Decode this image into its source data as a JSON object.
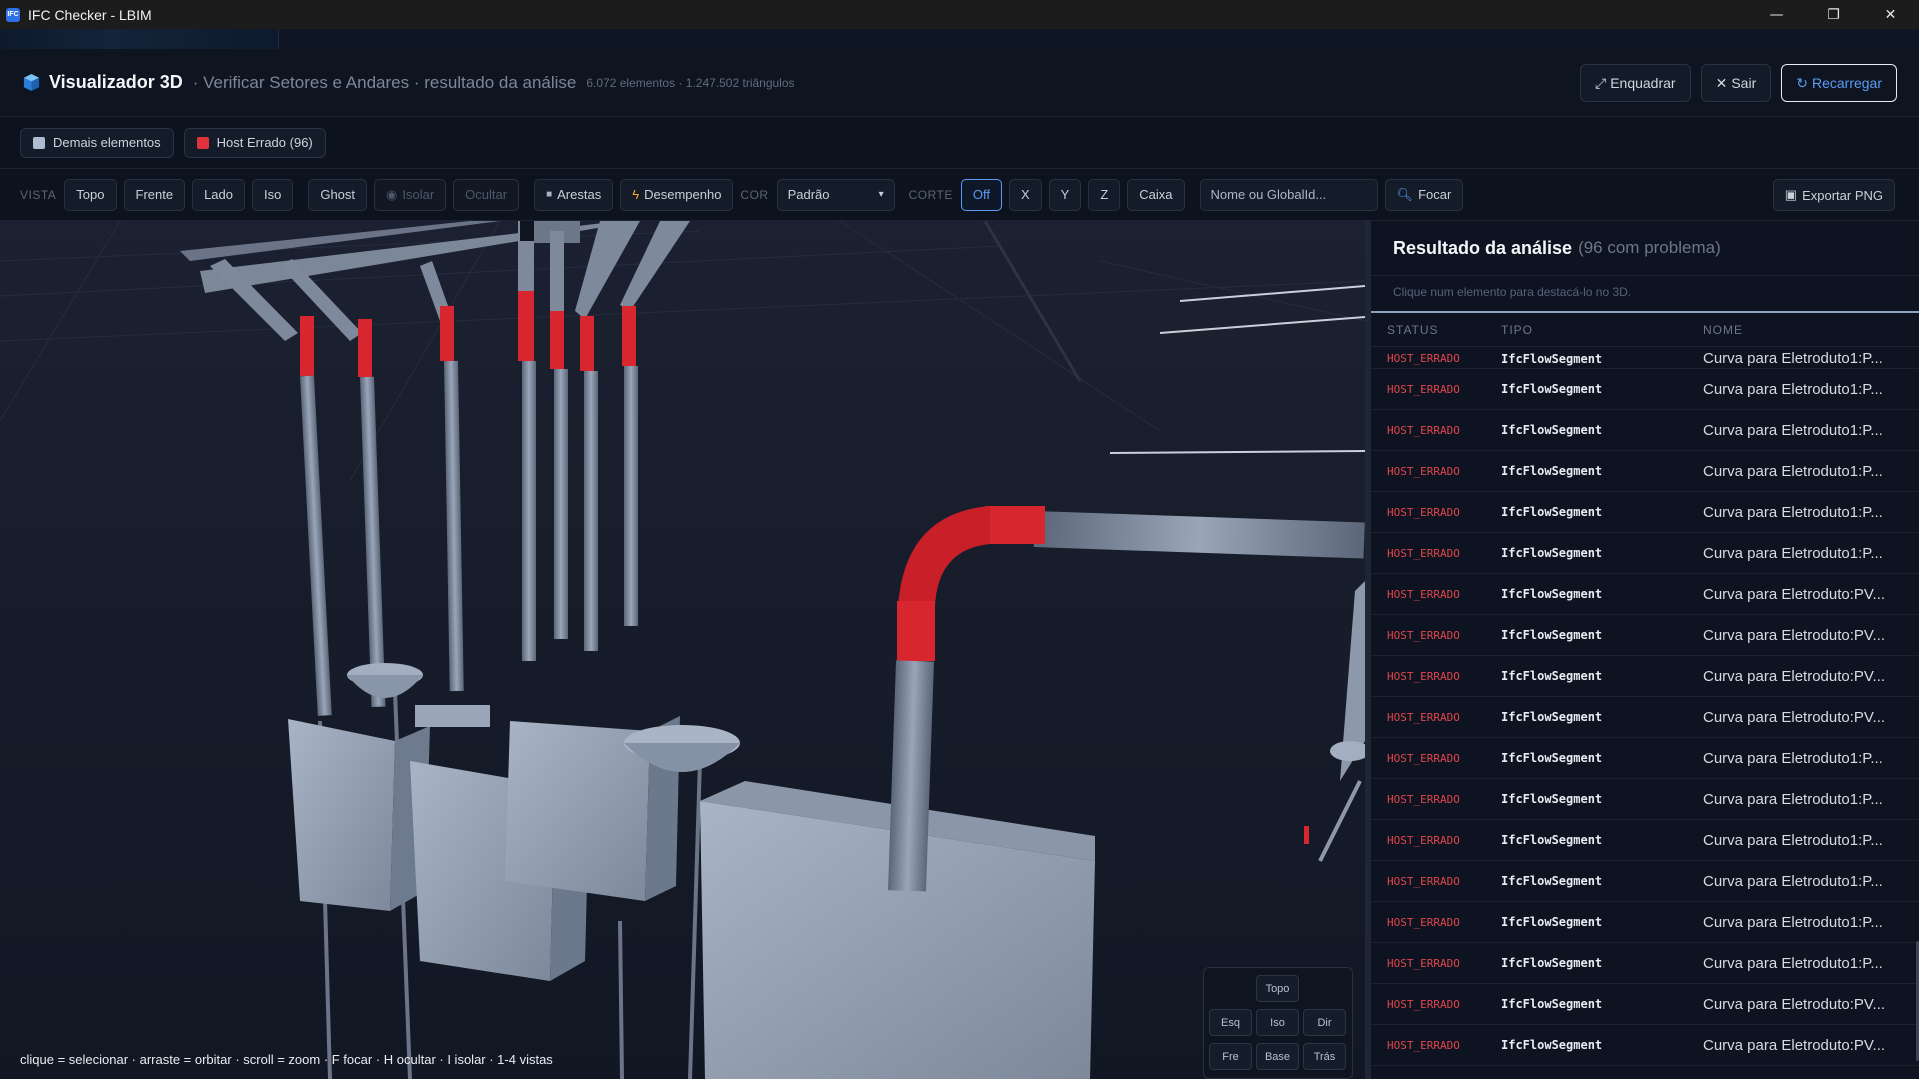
{
  "window": {
    "title": "IFC Checker - LBIM",
    "controls": [
      "minimize",
      "restore",
      "close"
    ]
  },
  "header": {
    "title": "Visualizador 3D",
    "subtitle": "· Verificar Setores e Andares · resultado da análise",
    "stats": "6.072 elementos · 1.247.502 triângulos",
    "actions": {
      "frame": "Enquadrar",
      "exit": "Sair",
      "reload": "Recarregar"
    }
  },
  "legend": {
    "items": [
      {
        "label": "Demais elementos",
        "color": "#aebbd0"
      },
      {
        "label": "Host Errado (96)",
        "color": "#e0343c"
      }
    ]
  },
  "toolbar": {
    "view_label": "VISTA",
    "views": [
      "Topo",
      "Frente",
      "Lado",
      "Iso"
    ],
    "ghost": "Ghost",
    "isolate": "Isolar",
    "hide": "Ocultar",
    "edges": "Arestas",
    "performance": "Desempenho",
    "color_label": "COR",
    "color_value": "Padrão",
    "cut_label": "CORTE",
    "cuts": [
      "Off",
      "X",
      "Y",
      "Z",
      "Caixa"
    ],
    "search_placeholder": "Nome ou GlobalId...",
    "focus": "Focar",
    "export": "Exportar PNG"
  },
  "viewport": {
    "hint": "clique = selecionar · arraste = orbitar · scroll = zoom · F focar · H ocultar · I isolar · 1-4 vistas",
    "navcube": {
      "top": "Topo",
      "left": "Esq",
      "iso": "Iso",
      "right": "Dir",
      "front": "Fre",
      "base": "Base",
      "back": "Trás"
    }
  },
  "panel": {
    "title": "Resultado da análise",
    "count": "(96 com problema)",
    "hint": "Clique num elemento para destacá-lo no 3D.",
    "columns": [
      "STATUS",
      "TIPO",
      "NOME"
    ],
    "rows": [
      {
        "status": "HOST_ERRADO",
        "tipo": "IfcFlowSegment",
        "nome": "Curva para Eletroduto1:P..."
      },
      {
        "status": "HOST_ERRADO",
        "tipo": "IfcFlowSegment",
        "nome": "Curva para Eletroduto1:P..."
      },
      {
        "status": "HOST_ERRADO",
        "tipo": "IfcFlowSegment",
        "nome": "Curva para Eletroduto1:P..."
      },
      {
        "status": "HOST_ERRADO",
        "tipo": "IfcFlowSegment",
        "nome": "Curva para Eletroduto1:P..."
      },
      {
        "status": "HOST_ERRADO",
        "tipo": "IfcFlowSegment",
        "nome": "Curva para Eletroduto1:P..."
      },
      {
        "status": "HOST_ERRADO",
        "tipo": "IfcFlowSegment",
        "nome": "Curva para Eletroduto1:P..."
      },
      {
        "status": "HOST_ERRADO",
        "tipo": "IfcFlowSegment",
        "nome": "Curva para Eletroduto:PV..."
      },
      {
        "status": "HOST_ERRADO",
        "tipo": "IfcFlowSegment",
        "nome": "Curva para Eletroduto:PV..."
      },
      {
        "status": "HOST_ERRADO",
        "tipo": "IfcFlowSegment",
        "nome": "Curva para Eletroduto:PV..."
      },
      {
        "status": "HOST_ERRADO",
        "tipo": "IfcFlowSegment",
        "nome": "Curva para Eletroduto:PV..."
      },
      {
        "status": "HOST_ERRADO",
        "tipo": "IfcFlowSegment",
        "nome": "Curva para Eletroduto1:P..."
      },
      {
        "status": "HOST_ERRADO",
        "tipo": "IfcFlowSegment",
        "nome": "Curva para Eletroduto1:P..."
      },
      {
        "status": "HOST_ERRADO",
        "tipo": "IfcFlowSegment",
        "nome": "Curva para Eletroduto1:P..."
      },
      {
        "status": "HOST_ERRADO",
        "tipo": "IfcFlowSegment",
        "nome": "Curva para Eletroduto1:P..."
      },
      {
        "status": "HOST_ERRADO",
        "tipo": "IfcFlowSegment",
        "nome": "Curva para Eletroduto1:P..."
      },
      {
        "status": "HOST_ERRADO",
        "tipo": "IfcFlowSegment",
        "nome": "Curva para Eletroduto1:P..."
      },
      {
        "status": "HOST_ERRADO",
        "tipo": "IfcFlowSegment",
        "nome": "Curva para Eletroduto:PV..."
      },
      {
        "status": "HOST_ERRADO",
        "tipo": "IfcFlowSegment",
        "nome": "Curva para Eletroduto:PV..."
      }
    ]
  },
  "colors": {
    "accent": "#5a9cf5",
    "error": "#e0343c",
    "background": "#0b101b"
  }
}
